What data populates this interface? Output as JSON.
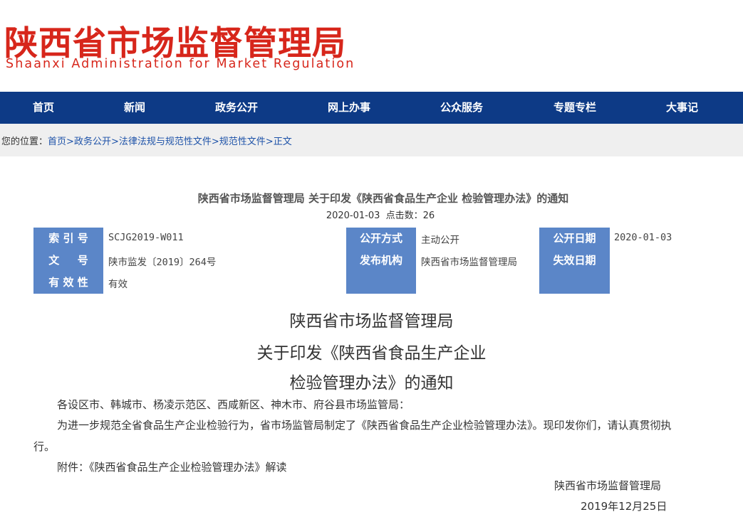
{
  "header": {
    "logo_cn": "陕西省市场监督管理局",
    "logo_en": "Shaanxi Administration for Market Regulation"
  },
  "nav": {
    "items": [
      {
        "label": "首页"
      },
      {
        "label": "新闻"
      },
      {
        "label": "政务公开"
      },
      {
        "label": "网上办事"
      },
      {
        "label": "公众服务"
      },
      {
        "label": "专题专栏"
      },
      {
        "label": "大事记"
      }
    ]
  },
  "breadcrumb": {
    "prefix": "您的位置：",
    "items": [
      "首页",
      "政务公开",
      "法律法规与规范性文件",
      "规范性文件",
      "正文"
    ],
    "separator": ">"
  },
  "document": {
    "title": "陕西省市场监督管理局 关于印发《陕西省食品生产企业 检验管理办法》的通知",
    "date": "2020-01-03",
    "hits": "点击数：26",
    "meta": {
      "index_label": "索 引 号",
      "index_value": "SCJG2019-W011",
      "docno_label": "文 　 号",
      "docno_value": "陕市监发〔2019〕264号",
      "validity_label": "有 效 性",
      "validity_value": "有效",
      "open_mode_label": "公开方式",
      "open_mode_value": "主动公开",
      "issuer_label": "发布机构",
      "issuer_value": "陕西省市场监督管理局",
      "open_date_label": "公开日期",
      "open_date_value": "2020-01-03",
      "expire_label": "失效日期"
    },
    "heading": [
      "陕西省市场监督管理局",
      "关于印发《陕西省食品生产企业",
      "检验管理办法》的通知"
    ],
    "body": {
      "salutation": "各设区市、韩城市、杨凌示范区、西咸新区、神木市、府谷县市场监管局：",
      "para1_line1": "为进一步规范全省食品生产企业检验行为，省市场监管局制定了《陕西省食品生产企业检验管理办法》。现印发你们，请认真贯彻执",
      "para1_line2": "行。",
      "attachment": "附件：《陕西省食品生产企业检验管理办法》解读"
    },
    "signature": {
      "org": "陕西省市场监督管理局",
      "date": "2019年12月25日"
    }
  },
  "colors": {
    "logo_red": "#d7261b",
    "nav_blue": "#0d3a86",
    "label_blue": "#5b86c8",
    "link_blue": "#1d52a8"
  }
}
